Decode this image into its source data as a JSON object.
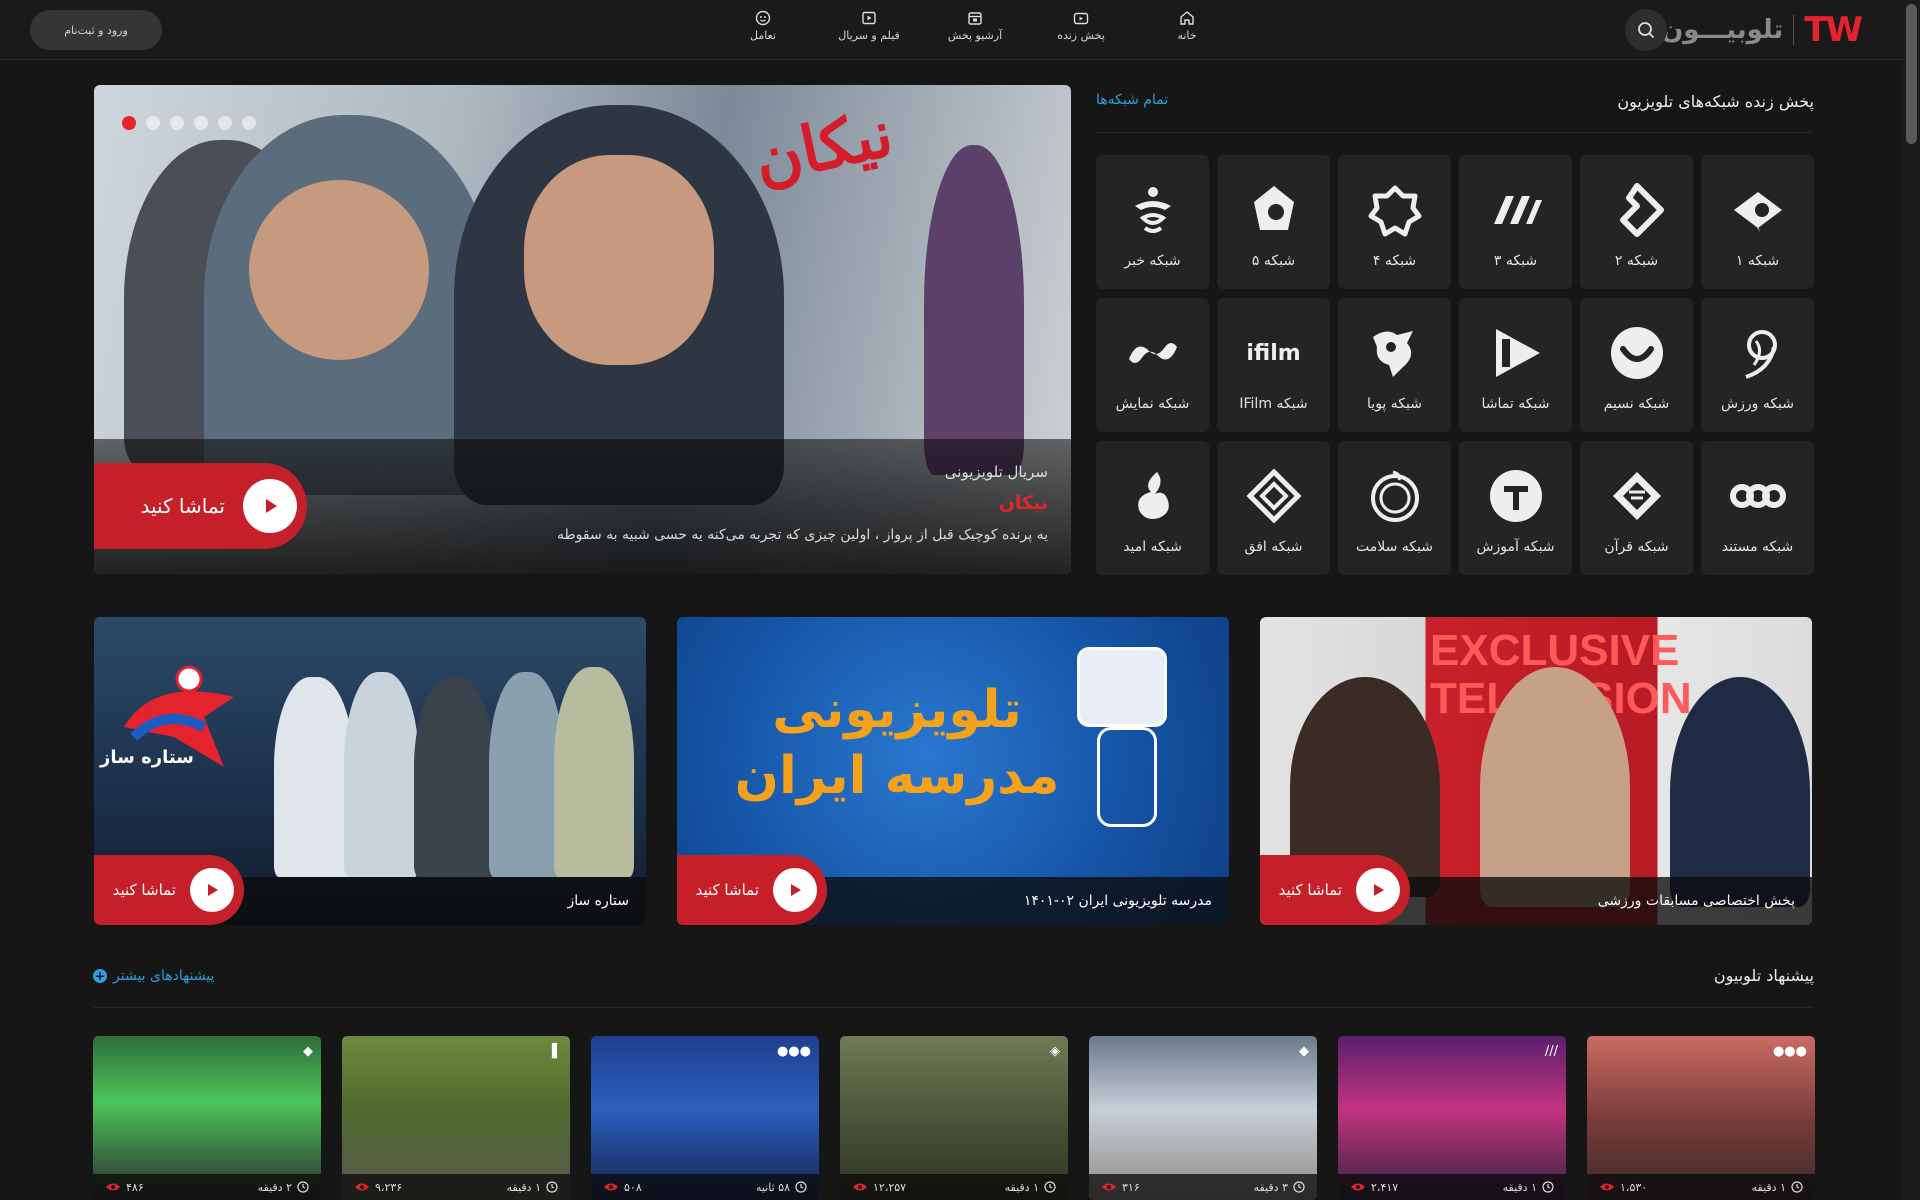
{
  "header": {
    "logo_mark": "TW",
    "logo_text": "تلوبیـــون",
    "login_label": "ورود و ثبت‌نام",
    "nav": [
      {
        "label": "خانه",
        "icon": "home-icon"
      },
      {
        "label": "پخش زنده",
        "icon": "live-tv-icon"
      },
      {
        "label": "آرشیو پخش",
        "icon": "calendar-icon"
      },
      {
        "label": "فیلم و سریال",
        "icon": "film-icon"
      },
      {
        "label": "تعامل",
        "icon": "interaction-icon"
      }
    ]
  },
  "hero": {
    "kicker": "سریال تلویزیونی",
    "title": "نیکان",
    "description": "یه پرنده کوچیک قبل از پرواز ، اولین چیزی که تجربه می‌کنه یه حسی شبیه به سقوطه",
    "watch_label": "تماشا کنید",
    "artwork_text": "نیکان",
    "slides": 6,
    "active_slide": 1
  },
  "channels": {
    "title": "پخش زنده شبکه‌های تلویزیون",
    "all_link": "تمام شبکه‌ها",
    "items": [
      {
        "label": "شبکه ۱",
        "icon": "channel-1-logo-icon"
      },
      {
        "label": "شبکه ۲",
        "icon": "channel-2-logo-icon"
      },
      {
        "label": "شبکه ۳",
        "icon": "channel-3-logo-icon"
      },
      {
        "label": "شبکه ۴",
        "icon": "channel-4-logo-icon"
      },
      {
        "label": "شبکه ۵",
        "icon": "channel-5-logo-icon"
      },
      {
        "label": "شبکه خبر",
        "icon": "khabar-logo-icon"
      },
      {
        "label": "شبکه ورزش",
        "icon": "varzesh-logo-icon"
      },
      {
        "label": "شبکه نسیم",
        "icon": "nasim-logo-icon"
      },
      {
        "label": "شبکه تماشا",
        "icon": "tamasha-logo-icon"
      },
      {
        "label": "شبکه پویا",
        "icon": "pouya-logo-icon"
      },
      {
        "label": "شبکه IFilm",
        "icon": "ifilm-logo-icon",
        "logo_text": "ifilm"
      },
      {
        "label": "شبکه نمایش",
        "icon": "namayesh-logo-icon"
      },
      {
        "label": "شبکه مستند",
        "icon": "mostanad-logo-icon"
      },
      {
        "label": "شبکه قرآن",
        "icon": "quran-logo-icon"
      },
      {
        "label": "شبکه آموزش",
        "icon": "amouzesh-logo-icon"
      },
      {
        "label": "شبکه سلامت",
        "icon": "salamat-logo-icon"
      },
      {
        "label": "شبکه افق",
        "icon": "ofogh-logo-icon"
      },
      {
        "label": "شبکه امید",
        "icon": "omid-logo-icon"
      }
    ]
  },
  "promos": [
    {
      "title": "پخش اختصاصی مسابقات ورزشی",
      "watch_label": "تماشا کنید",
      "art_text": "EXCLUSIVE TELEVISION"
    },
    {
      "title": "مدرسه تلویزیونی ایران ۰۲-۱۴۰۱",
      "watch_label": "تماشا کنید",
      "art_text": "تلویزیونی مدرسه ایران"
    },
    {
      "title": "ستاره ساز",
      "watch_label": "تماشا کنید",
      "art_text": "ستاره ساز"
    }
  ],
  "recommendations": {
    "title": "پیشنهاد تلوبیون",
    "more_link": "پیشنهادهای بیشتر",
    "items": [
      {
        "duration": "۱ دقیقه",
        "views": "۱،۵۳۰"
      },
      {
        "duration": "۱ دقیقه",
        "views": "۲،۴۱۷"
      },
      {
        "duration": "۳ دقیقه",
        "views": "۳۱۶"
      },
      {
        "duration": "۱ دقیقه",
        "views": "۱۲،۲۵۷"
      },
      {
        "duration": "۵۸ ثانیه",
        "views": "۵۰۸"
      },
      {
        "duration": "۱ دقیقه",
        "views": "۹،۲۳۶"
      },
      {
        "duration": "۲ دقیقه",
        "views": "۴۸۶"
      }
    ]
  },
  "colors": {
    "accent": "#e5232d",
    "link": "#2d9ee0",
    "background": "#161616",
    "card": "#242424"
  }
}
